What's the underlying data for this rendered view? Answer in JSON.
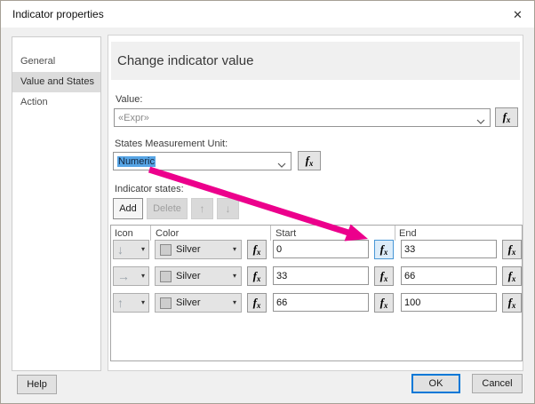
{
  "window": {
    "title": "Indicator properties",
    "close_icon": "✕"
  },
  "sidebar": {
    "items": [
      {
        "label": "General",
        "selected": false
      },
      {
        "label": "Value and States",
        "selected": true
      },
      {
        "label": "Action",
        "selected": false
      }
    ]
  },
  "main": {
    "heading": "Change indicator value",
    "value": {
      "label": "Value:",
      "value": "«Expr»"
    },
    "measurement_unit": {
      "label": "States Measurement Unit:",
      "value": "Numeric"
    },
    "states": {
      "label": "Indicator states:",
      "toolbar": {
        "add": "Add",
        "delete": "Delete",
        "up_icon": "↑",
        "down_icon": "↓"
      },
      "table": {
        "headers": [
          "Icon",
          "Color",
          "Start",
          "End"
        ],
        "rows": [
          {
            "icon": "down-arrow",
            "icon_glyph": "↓",
            "color": "Silver",
            "start": "0",
            "end": "33",
            "start_fx_highlighted": true
          },
          {
            "icon": "right-arrow",
            "icon_glyph": "→",
            "color": "Silver",
            "start": "33",
            "end": "66",
            "start_fx_highlighted": false
          },
          {
            "icon": "up-arrow",
            "icon_glyph": "↑",
            "color": "Silver",
            "start": "66",
            "end": "100",
            "start_fx_highlighted": false
          }
        ]
      }
    }
  },
  "footer": {
    "help": "Help",
    "ok": "OK",
    "cancel": "Cancel"
  },
  "icons": {
    "fx_main": "f",
    "fx_sub": "x",
    "caret": "▾"
  },
  "colors": {
    "accent_blue": "#0078d7",
    "annotation_arrow": "#ec008c",
    "selection_highlight": "#57a5e5",
    "silver_swatch": "#cdcdcd",
    "fx_highlight_bg": "#dcecf9",
    "fx_highlight_border": "#4897d6"
  }
}
